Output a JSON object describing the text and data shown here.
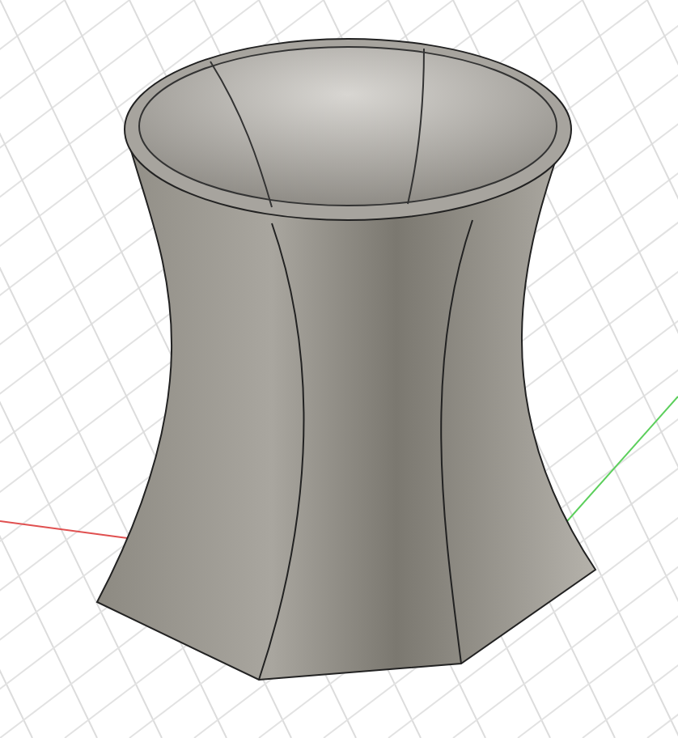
{
  "viewport": {
    "axes_shown": true,
    "grid_shown": true
  }
}
